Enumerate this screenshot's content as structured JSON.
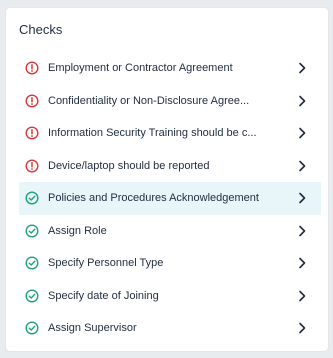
{
  "panel": {
    "title": "Checks"
  },
  "colors": {
    "error": "#d93838",
    "success": "#1fa27a",
    "active_bg": "#e8f5f9",
    "text": "#1f2d3d"
  },
  "items": [
    {
      "label": "Employment or Contractor Agreement",
      "status": "error",
      "icon": "alert-circle-icon"
    },
    {
      "label": "Confidentiality or Non-Disclosure Agree...",
      "status": "error",
      "icon": "alert-circle-icon"
    },
    {
      "label": "Information Security Training should be c...",
      "status": "error",
      "icon": "alert-circle-icon"
    },
    {
      "label": "Device/laptop should be reported",
      "status": "error",
      "icon": "alert-circle-icon"
    },
    {
      "label": "Policies and Procedures Acknowledgement",
      "status": "success",
      "icon": "check-circle-icon",
      "active": true
    },
    {
      "label": "Assign Role",
      "status": "success",
      "icon": "check-circle-icon"
    },
    {
      "label": "Specify Personnel Type",
      "status": "success",
      "icon": "check-circle-icon"
    },
    {
      "label": "Specify date of Joining",
      "status": "success",
      "icon": "check-circle-icon"
    },
    {
      "label": "Assign Supervisor",
      "status": "success",
      "icon": "check-circle-icon"
    }
  ]
}
